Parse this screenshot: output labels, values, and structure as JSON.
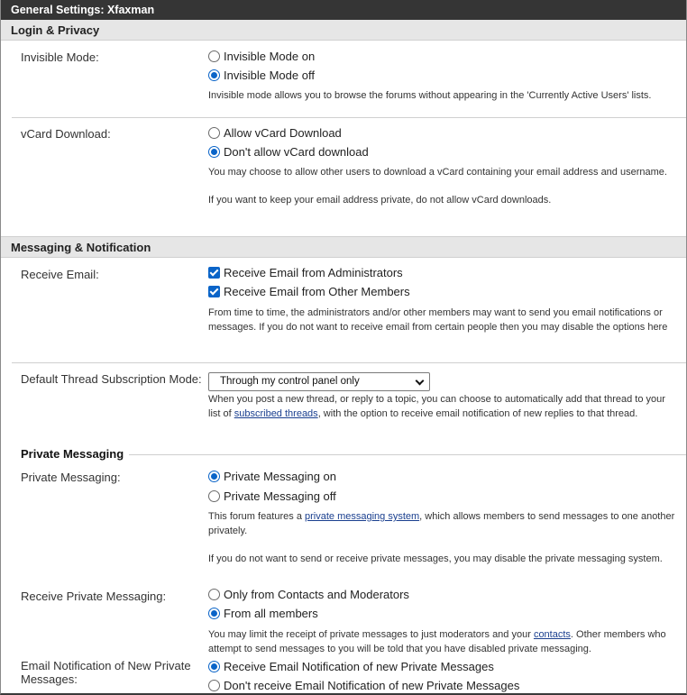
{
  "window_title": "General Settings: Xfaxman",
  "sections": {
    "login_privacy": {
      "title": "Login & Privacy",
      "invisible_mode": {
        "label": "Invisible Mode:",
        "options": [
          "Invisible Mode on",
          "Invisible Mode off"
        ],
        "selected": "Invisible Mode off",
        "description": "Invisible mode allows you to browse the forums without appearing in the 'Currently Active Users' lists."
      },
      "vcard": {
        "label": "vCard Download:",
        "options": [
          "Allow vCard Download",
          "Don't allow vCard download"
        ],
        "selected": "Don't allow vCard download",
        "description1": "You may choose to allow other users to download a vCard containing your email address and username.",
        "description2": "If you want to keep your email address private, do not allow vCard downloads."
      }
    },
    "messaging": {
      "title": "Messaging & Notification",
      "receive_email": {
        "label": "Receive Email:",
        "options": [
          "Receive Email from Administrators",
          "Receive Email from Other Members"
        ],
        "checked": [
          true,
          true
        ],
        "description": "From time to time, the administrators and/or other members may want to send you email notifications or messages. If you do not want to receive email from certain people then you may disable the options here"
      },
      "thread_subscription": {
        "label": "Default Thread Subscription Mode:",
        "selected_value": "Through my control panel only",
        "desc_before": "When you post a new thread, or reply to a topic, you can choose to automatically add that thread to your list of ",
        "link": "subscribed threads",
        "desc_after": ", with the option to receive email notification of new replies to that thread."
      },
      "private_messaging_heading": "Private Messaging",
      "private_messaging": {
        "label": "Private Messaging:",
        "options": [
          "Private Messaging on",
          "Private Messaging off"
        ],
        "selected": "Private Messaging on",
        "desc1_before": "This forum features a ",
        "desc1_link": "private messaging system",
        "desc1_after": ", which allows members to send messages to one another privately.",
        "desc2": "If you do not want to send or receive private messages, you may disable the private messaging system."
      },
      "receive_pm": {
        "label": "Receive Private Messaging:",
        "options": [
          "Only from Contacts and Moderators",
          "From all members"
        ],
        "selected": "From all members",
        "desc_before": "You may limit the receipt of private messages to just moderators and your ",
        "desc_link": "contacts",
        "desc_after": ". Other members who attempt to send messages to you will be told that you have disabled private messaging."
      },
      "email_notification_pm": {
        "label": "Email Notification of New Private Messages:",
        "options": [
          "Receive Email Notification of new Private Messages",
          "Don't receive Email Notification of new Private Messages"
        ],
        "selected": "Receive Email Notification of new Private Messages"
      }
    }
  },
  "colors": {
    "titlebar_bg": "#353535",
    "section_bg": "#e6e6e6",
    "accent": "#0a64c8",
    "link": "#1a3f8f"
  }
}
